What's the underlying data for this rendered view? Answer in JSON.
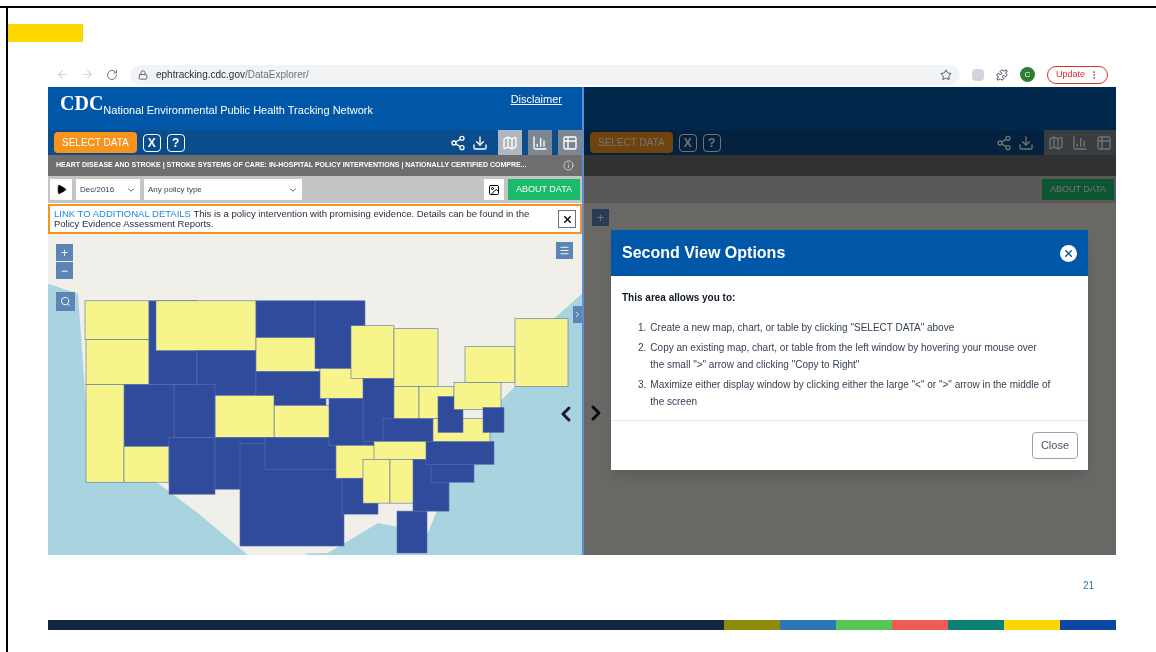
{
  "browser": {
    "url_host": "ephtracking.cdc.gov",
    "url_path": "/DataExplorer/",
    "profile_initial": "C",
    "update_label": "Update"
  },
  "left_panel": {
    "logo": "CDC",
    "site_title": "National Environmental Public Health Tracking Network",
    "disclaimer": "Disclaimer",
    "select_data": "SELECT DATA",
    "clear_label": "X",
    "help_label": "?",
    "views": [
      {
        "kind": "map",
        "selected": true
      },
      {
        "kind": "chart",
        "selected": false
      },
      {
        "kind": "table",
        "selected": false
      }
    ],
    "breadcrumb": "HEART DISEASE AND STROKE | STROKE SYSTEMS OF CARE: IN-HOSPITAL POLICY INTERVENTIONS | NATIONALLY CERTIFIED COMPRE...",
    "date": "Dec/2016",
    "policy_type": "Any policy type",
    "about_data": "ABOUT DATA",
    "notice": {
      "link": "LINK TO ADDITIONAL DETAILS",
      "text": "This is a policy intervention with promising evidence. Details can be found in the Policy Evidence Assessment Reports."
    },
    "zoom_in": "+",
    "zoom_out": "−"
  },
  "right_panel": {
    "select_data": "SELECT DATA",
    "clear_label": "X",
    "help_label": "?",
    "about_data": "ABOUT DATA",
    "zoom_in": "+"
  },
  "modal": {
    "open": true,
    "title": "Second View Options",
    "intro": "This area allows you to:",
    "items": [
      {
        "number": "1.",
        "text": "Create a new map, chart, or table by clicking \"SELECT DATA\" above"
      },
      {
        "number": "2.",
        "text": "Copy an existing map, chart, or table from the left window by hovering your mouse over the small \">\" arrow and clicking \"Copy to Right\""
      },
      {
        "number": "3.",
        "text": "Maximize either display window by clicking either the large \"<\" or \">\" arrow in the middle of the screen"
      }
    ],
    "close": "Close"
  },
  "slide": {
    "page_number": "21",
    "stripe": [
      {
        "color": "#8c8c0a"
      },
      {
        "color": "#2e75b6"
      },
      {
        "color": "#55c757"
      },
      {
        "color": "#ef5b57"
      },
      {
        "color": "#0b8173"
      },
      {
        "color": "#ffd700"
      },
      {
        "color": "#0d47a1"
      }
    ]
  }
}
